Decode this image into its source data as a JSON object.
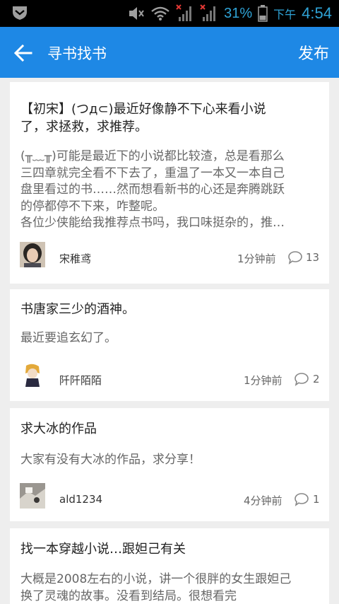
{
  "status_bar": {
    "battery_percent": "31%",
    "ampm": "下午",
    "time": "4:54",
    "icons": [
      "shield-icon",
      "mute-icon",
      "wifi-icon",
      "signal-icon",
      "signal-icon",
      "battery-icon"
    ],
    "accent": "#2fa3d6"
  },
  "app_bar": {
    "title": "寻书找书",
    "publish_label": "发布",
    "back_icon": "arrow-left-icon",
    "background": "#1e88e5"
  },
  "posts": [
    {
      "title_line1": "【初宋】(つд⊂)最近好像静不下心来看小说",
      "title_line2": "了，求拯救，求推荐。",
      "body_lines": [
        "(╥﹏╥)可能是最近下的小说都比较渣，总是看那么",
        "三四章就完全看不下去了，重温了一本又一本自己",
        "盘里看过的书……然而想看新书的心还是奔腾跳跃",
        "的停都停不下来，咋整呢。",
        "各位少侠能给我推荐点书吗，我口味挺杂的，推…"
      ],
      "author": "宋稚鸢",
      "time": "1分钟前",
      "comments": "13"
    },
    {
      "title_line1": "书唐家三少的酒神。",
      "body_lines": [
        "最近要追玄幻了。"
      ],
      "author": "阡阡陌陌",
      "time": "1分钟前",
      "comments": "2"
    },
    {
      "title_line1": "求大冰的作品",
      "body_lines": [
        "大家有没有大冰的作品，求分享！"
      ],
      "author": "ald1234",
      "time": "4分钟前",
      "comments": "1"
    },
    {
      "title_line1": "找一本穿越小说…跟妲己有关",
      "body_lines": [
        "大概是2008左右的小说，讲一个很胖的女生跟妲己",
        "换了灵魂的故事。没看到结局。很想看完"
      ]
    }
  ]
}
